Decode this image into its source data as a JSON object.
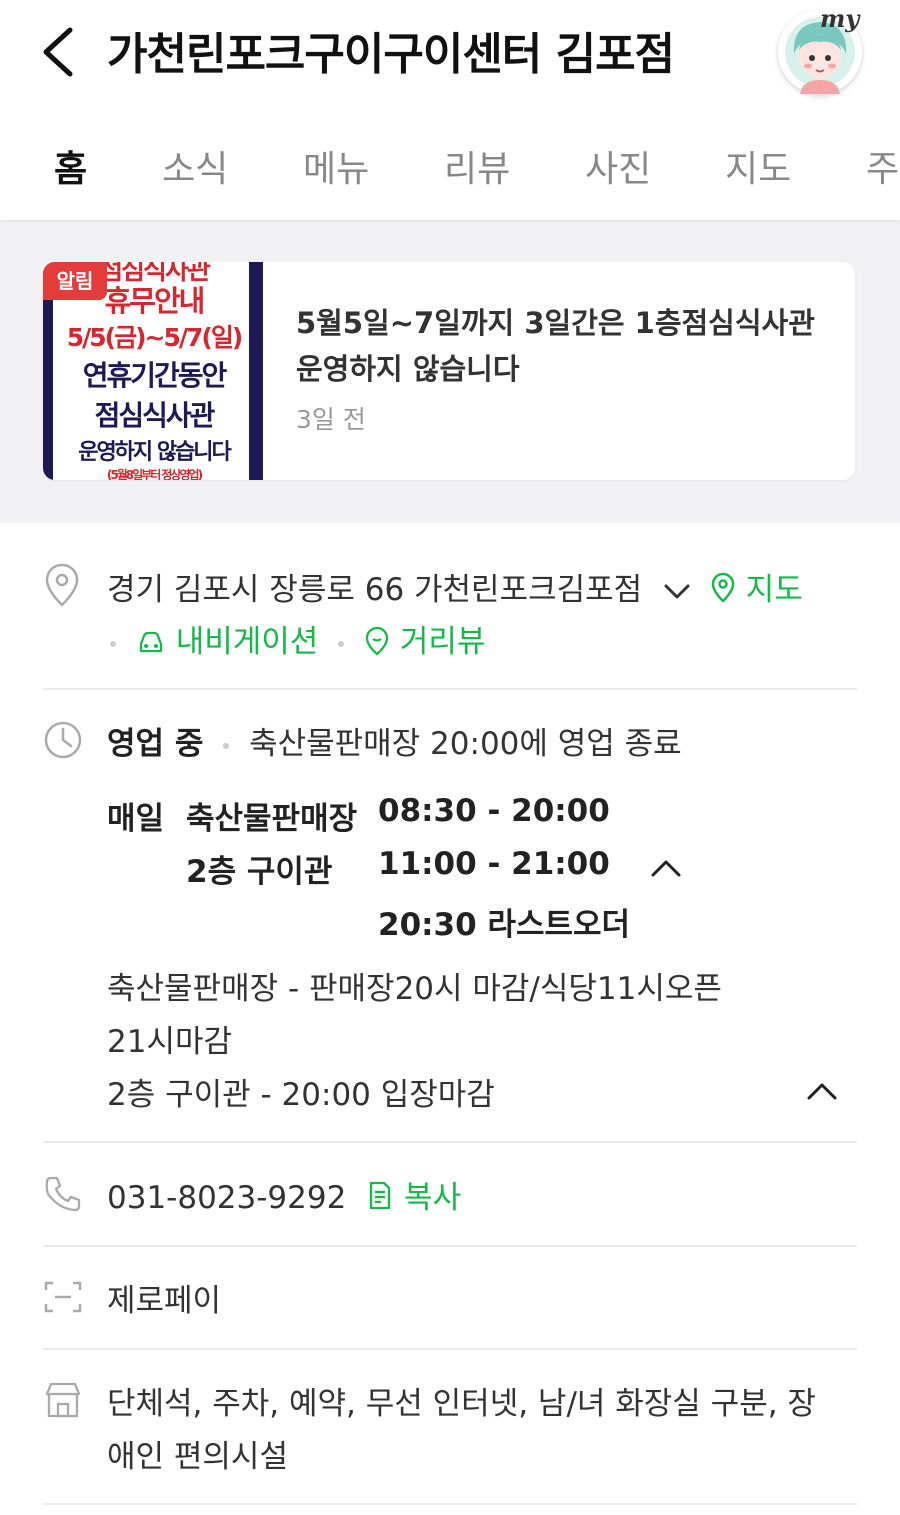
{
  "header": {
    "title": "가천린포크구이구이센터 김포점",
    "avatar_label": "my",
    "tabs": [
      "홈",
      "소식",
      "메뉴",
      "리뷰",
      "사진",
      "지도",
      "주"
    ]
  },
  "notice": {
    "badge": "알림",
    "image_lines": [
      "점심식사관",
      "휴무안내",
      "5/5(금)~5/7(일)",
      "연휴기간동안",
      "점심식사관",
      "운영하지 않습니다",
      "(5월8일부터 정상영업)"
    ],
    "text": "5월5일~7일까지 3일간은 1층점심식사관 운영하지 않습니다",
    "time": "3일 전"
  },
  "address": {
    "text": "경기 김포시 장릉로 66 가천린포크김포점",
    "map_link": "지도",
    "navigation_link": "내비게이션",
    "streetview_link": "거리뷰"
  },
  "hours": {
    "status": "영업 중",
    "summary": "축산물판매장 20:00에 영업 종료",
    "day": "매일",
    "entries": [
      {
        "place": "축산물판매장",
        "time": "08:30 - 20:00"
      },
      {
        "place": "2층 구이관",
        "time": "11:00 - 21:00"
      }
    ],
    "last_order": "20:30 라스트오더",
    "note_line1": "축산물판매장 - 판매장20시 마감/식당11시오픈",
    "note_line2": "21시마감",
    "note_line3": "2층 구이관 - 20:00 입장마감"
  },
  "phone": {
    "number": "031-8023-9292",
    "copy_label": "복사"
  },
  "payment": {
    "label": "제로페이"
  },
  "amenities": {
    "line1": "단체석, 주차, 예약, 무선 인터넷, 남/녀 화장실 구분, 장",
    "line2": "애인 편의시설"
  },
  "colors": {
    "accent_green": "#16b84a",
    "badge_red": "#e43b3b",
    "navy": "#1d1a55"
  }
}
